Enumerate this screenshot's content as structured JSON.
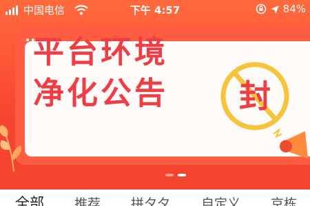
{
  "status_bar": {
    "carrier": "中国电信",
    "time": "下午 4:57",
    "battery": "84%",
    "icons": [
      "signal-icon",
      "wifi-icon",
      "rotation-lock-icon",
      "location-icon"
    ]
  },
  "banner": {
    "headline_line1": "平台环境",
    "headline_line2": "净化公告",
    "seal_text": "封",
    "colors": {
      "accent": "#ef3c45",
      "seal_ring": "#f6c33b",
      "background": "#f8452f"
    },
    "pager": {
      "count": 2,
      "active_index": 1
    }
  },
  "tabs": [
    {
      "label": "全部"
    },
    {
      "label": "推荐"
    },
    {
      "label": "拼夕夕"
    },
    {
      "label": "自定义"
    },
    {
      "label": "京栋"
    }
  ]
}
